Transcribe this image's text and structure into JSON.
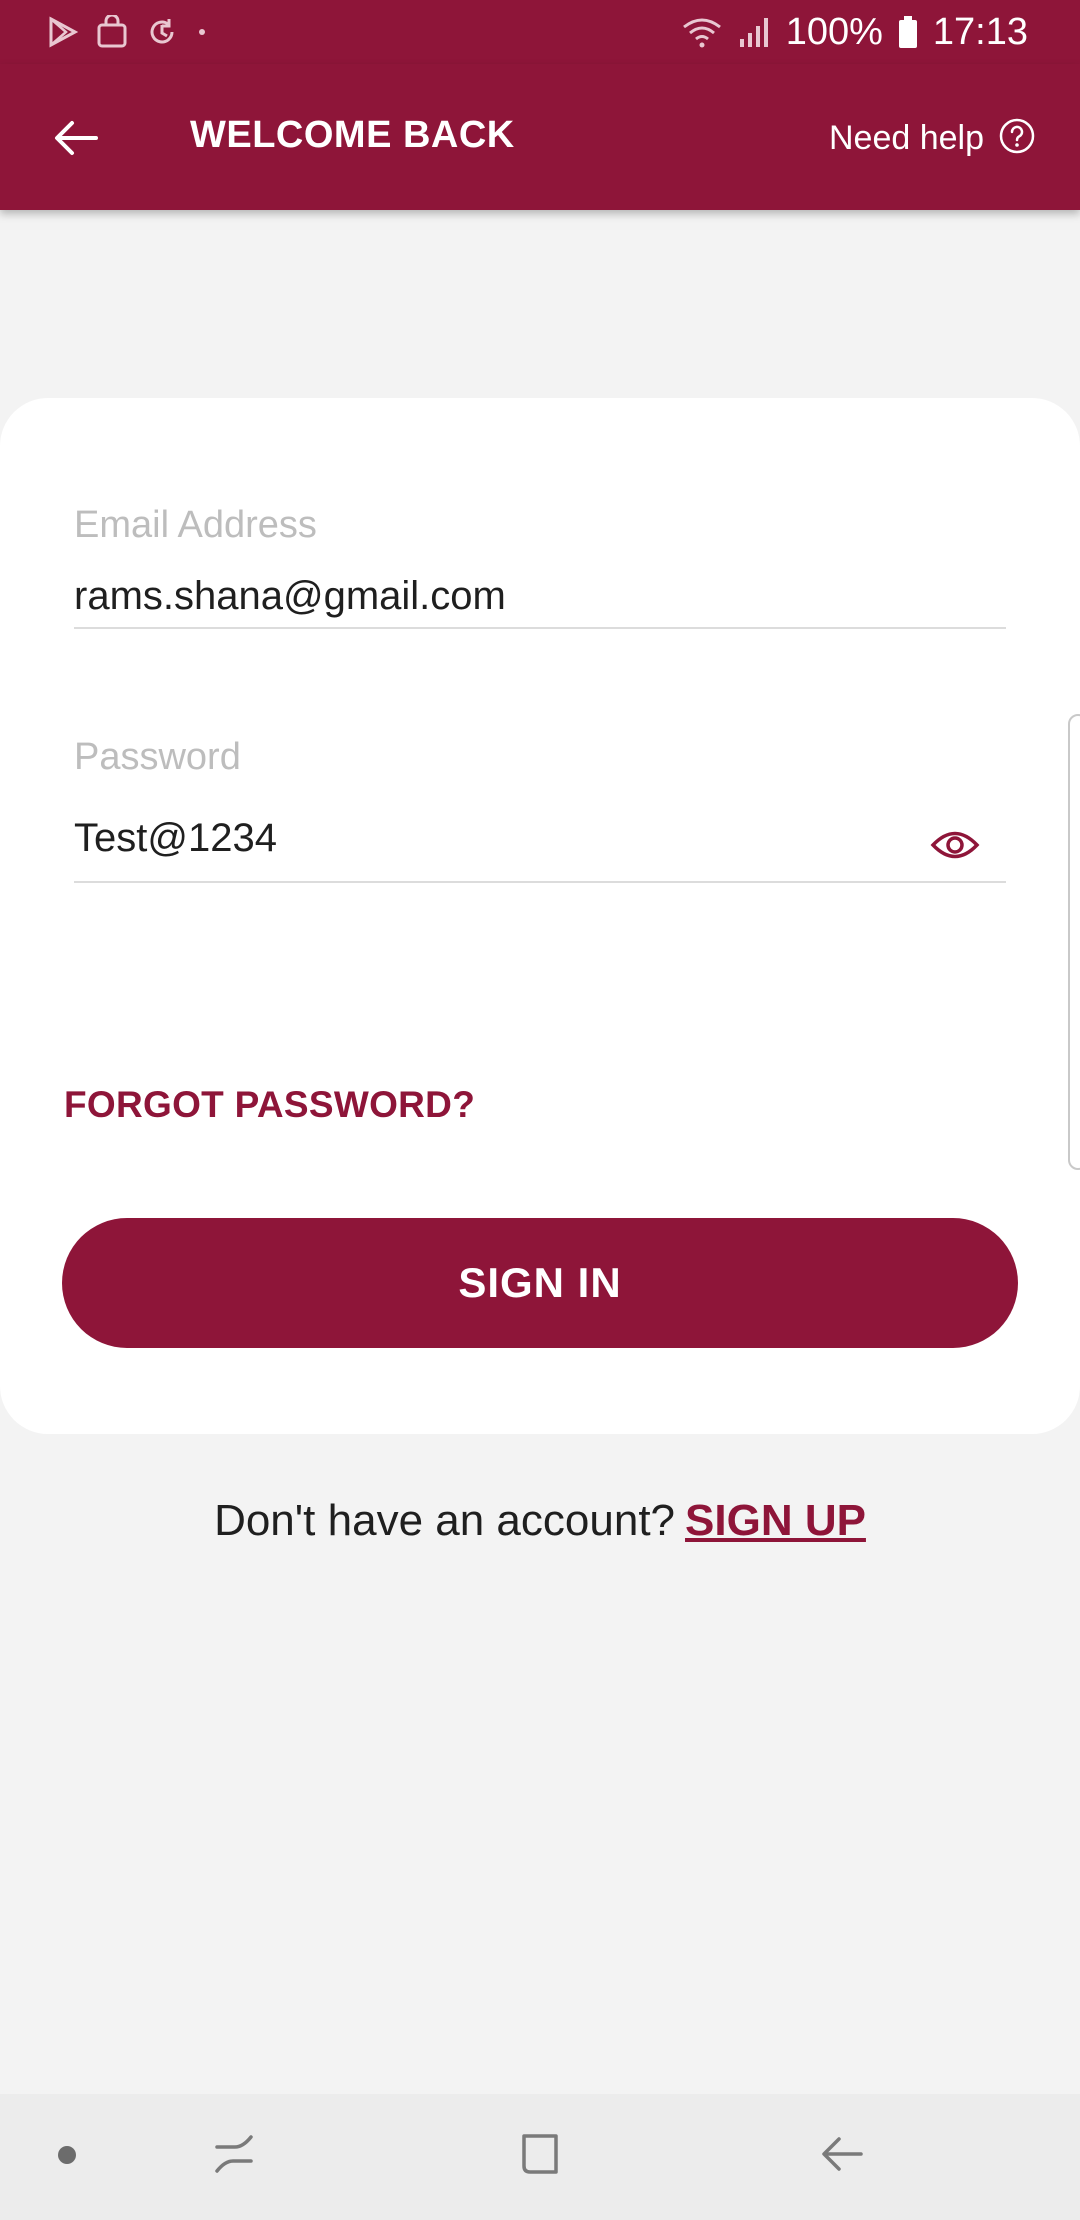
{
  "status_bar": {
    "battery": "100%",
    "time": "17:13",
    "icons": [
      "play-store-icon",
      "shopping-bag-icon",
      "sync-icon",
      "dot-icon",
      "wifi-icon",
      "signal-icon",
      "battery-icon"
    ]
  },
  "app_bar": {
    "title": "WELCOME BACK",
    "help_label": "Need help",
    "back_icon": "arrow-left-icon",
    "help_icon": "question-circle-icon"
  },
  "form": {
    "email": {
      "label": "Email Address",
      "value": "rams.shana@gmail.com"
    },
    "password": {
      "label": "Password",
      "value": "Test@1234",
      "toggle_icon": "eye-icon"
    },
    "forgot_password": "FORGOT PASSWORD?",
    "sign_in": "SIGN IN"
  },
  "footer": {
    "prompt": "Don't have an account?",
    "sign_up": "SIGN UP"
  },
  "nav_bar": {
    "icons": [
      "dot-icon",
      "recents-icon",
      "home-icon",
      "back-icon"
    ]
  },
  "colors": {
    "brand": "#8e1539",
    "background": "#f3f3f3",
    "card": "#ffffff",
    "label": "#bdbdbd",
    "text": "#1f1f1f"
  }
}
